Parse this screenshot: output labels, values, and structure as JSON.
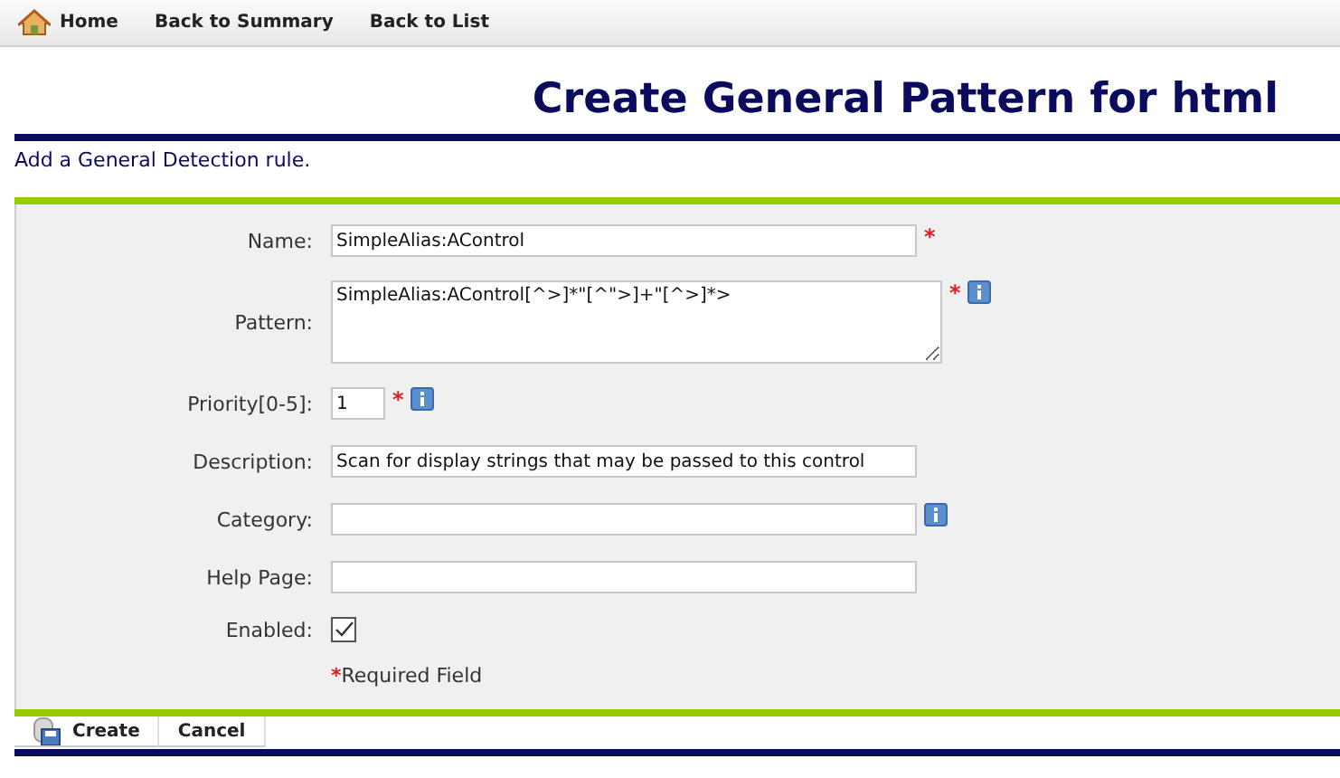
{
  "nav": [
    {
      "label": "Home"
    },
    {
      "label": "Back to Summary"
    },
    {
      "label": "Back to List"
    }
  ],
  "title": "Create General Pattern for html",
  "subtitle": "Add a General Detection rule.",
  "fields": [
    {
      "kind": "text",
      "label": "Name:",
      "value": "SimpleAlias:AControl",
      "marker": "*",
      "info": false
    },
    {
      "kind": "textarea",
      "label": "Pattern:",
      "value": "SimpleAlias:AControl[^>]*\"[^\">]+\"[^>]*>",
      "marker": "*",
      "info": true
    },
    {
      "kind": "number",
      "label": "Priority[0-5]:",
      "value": "1",
      "marker": "*",
      "info": true
    },
    {
      "kind": "text",
      "label": "Description:",
      "value": "Scan for display strings that may be passed to this control",
      "info": false
    },
    {
      "kind": "text",
      "label": "Category:",
      "info": true
    },
    {
      "kind": "text",
      "label": "Help Page:",
      "info": false
    },
    {
      "kind": "checkbox",
      "label": "Enabled:",
      "checked": true
    }
  ],
  "legend": {
    "marker": "*",
    "text": "Required Field"
  },
  "buttons": [
    {
      "label": "Create"
    },
    {
      "label": "Cancel"
    }
  ]
}
